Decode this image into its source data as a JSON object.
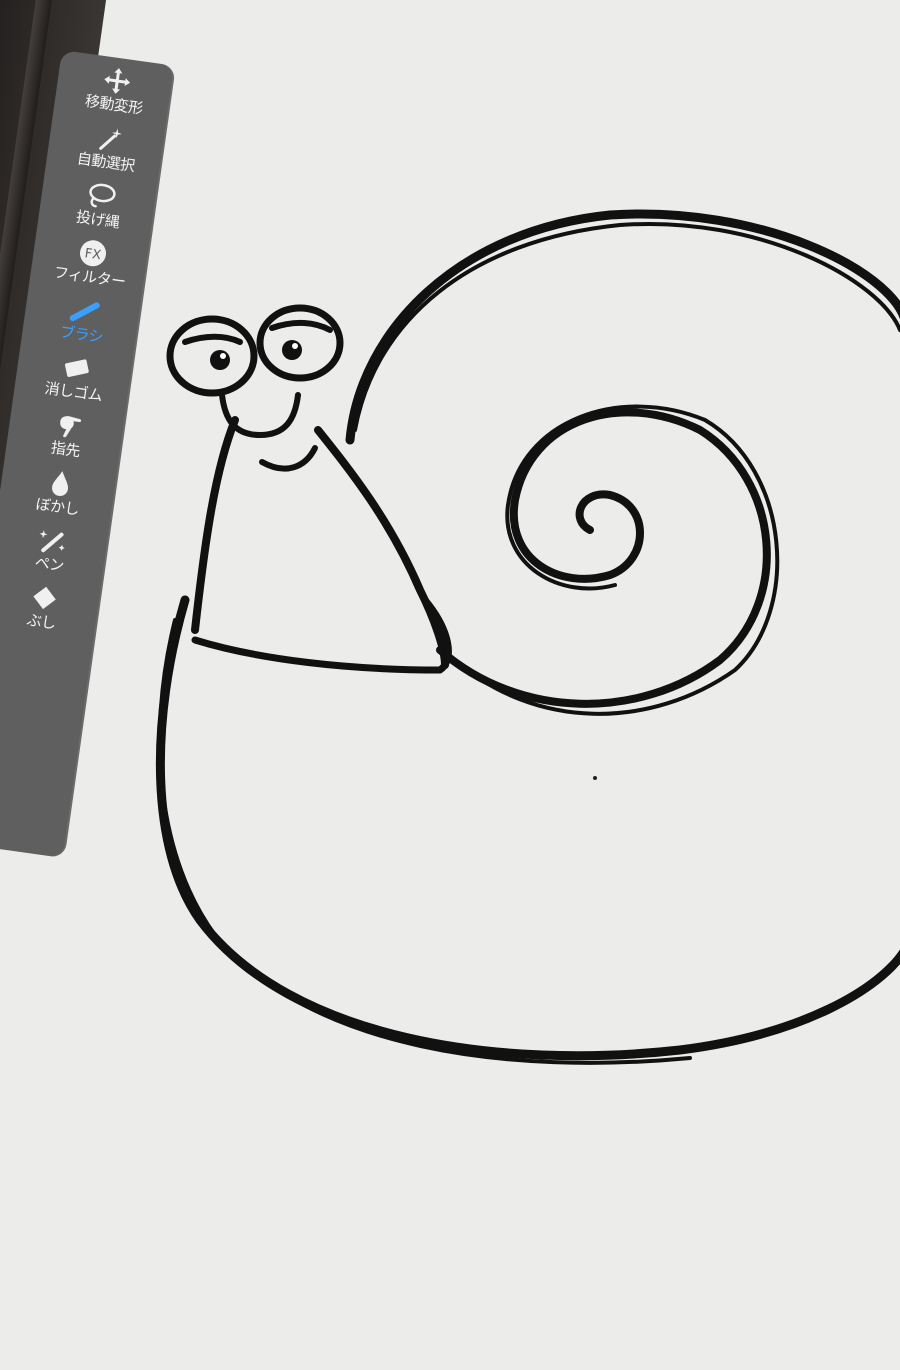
{
  "toolbar": {
    "tools": [
      {
        "label": "移動変形",
        "icon": "move-arrows-icon"
      },
      {
        "label": "自動選択",
        "icon": "magic-wand-icon"
      },
      {
        "label": "投げ縄",
        "icon": "lasso-icon"
      },
      {
        "label": "フィルター",
        "icon": "fx-icon",
        "icon_text": "FX"
      },
      {
        "label": "ブラシ",
        "icon": "brush-icon",
        "active": true
      },
      {
        "label": "消しゴム",
        "icon": "eraser-icon"
      },
      {
        "label": "指先",
        "icon": "finger-icon"
      },
      {
        "label": "ぼかし",
        "icon": "blur-drop-icon"
      },
      {
        "label": "ペン",
        "icon": "sparkle-pen-icon"
      },
      {
        "label": "ぶし",
        "icon": "fill-bucket-icon"
      }
    ],
    "active_color": "#3aa0ff",
    "background": "#5f5f5f"
  },
  "canvas": {
    "background": "#ececea",
    "ink_color": "#111111",
    "drawing": "snail-sketch"
  }
}
